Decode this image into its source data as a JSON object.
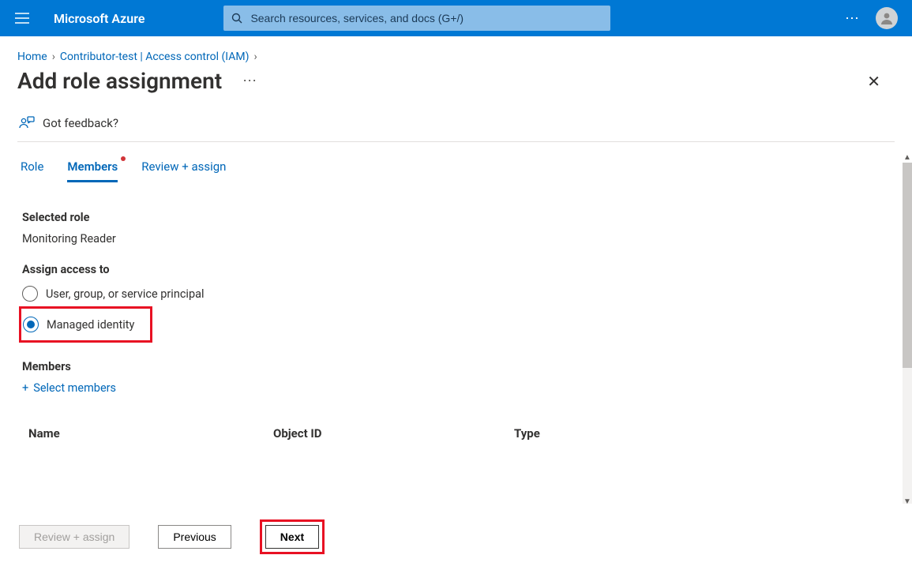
{
  "header": {
    "brand": "Microsoft Azure",
    "search_placeholder": "Search resources, services, and docs (G+/)",
    "more": "⋯"
  },
  "breadcrumbs": {
    "items": [
      "Home",
      "Contributor-test | Access control (IAM)"
    ]
  },
  "title": "Add role assignment",
  "feedback_label": "Got feedback?",
  "tabs": {
    "items": [
      {
        "label": "Role",
        "active": false,
        "dot": false
      },
      {
        "label": "Members",
        "active": true,
        "dot": true
      },
      {
        "label": "Review + assign",
        "active": false,
        "dot": false
      }
    ]
  },
  "form": {
    "selected_role_hd": "Selected role",
    "selected_role": "Monitoring Reader",
    "assign_hd": "Assign access to",
    "radio": {
      "user": "User, group, or service principal",
      "mi": "Managed identity"
    },
    "members_hd": "Members",
    "select_members": "Select members",
    "columns": {
      "name": "Name",
      "object_id": "Object ID",
      "type": "Type"
    }
  },
  "buttons": {
    "review": "Review + assign",
    "previous": "Previous",
    "next": "Next"
  }
}
